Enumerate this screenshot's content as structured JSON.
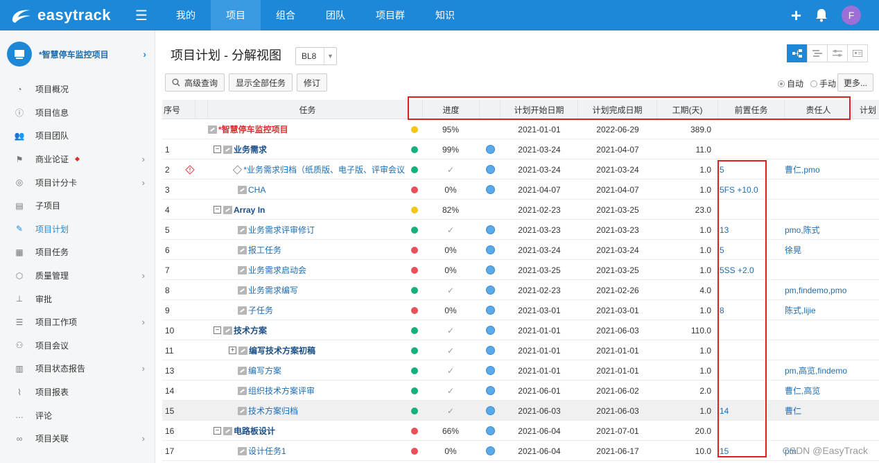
{
  "topbar": {
    "logo_text": "easytrack",
    "nav": [
      "我的",
      "项目",
      "组合",
      "团队",
      "项目群",
      "知识"
    ],
    "active_nav": 1,
    "avatar_letter": "F"
  },
  "sidebar": {
    "project_name": "*智慧停车监控项目",
    "items": [
      {
        "label": "项目概况",
        "icon": "pie-chart-icon",
        "chev": false
      },
      {
        "label": "项目信息",
        "icon": "info-icon",
        "chev": false
      },
      {
        "label": "项目团队",
        "icon": "team-icon",
        "chev": false
      },
      {
        "label": "商业论证",
        "icon": "flag-icon",
        "chev": true,
        "dot": true
      },
      {
        "label": "项目计分卡",
        "icon": "target-icon",
        "chev": true
      },
      {
        "label": "子项目",
        "icon": "subproject-icon",
        "chev": false
      },
      {
        "label": "项目计划",
        "icon": "plan-icon",
        "chev": false,
        "active": true
      },
      {
        "label": "项目任务",
        "icon": "task-icon",
        "chev": false
      },
      {
        "label": "质量管理",
        "icon": "quality-icon",
        "chev": true
      },
      {
        "label": "审批",
        "icon": "stamp-icon",
        "chev": false
      },
      {
        "label": "项目工作项",
        "icon": "workitem-icon",
        "chev": true
      },
      {
        "label": "项目会议",
        "icon": "meeting-icon",
        "chev": false
      },
      {
        "label": "项目状态报告",
        "icon": "report-icon",
        "chev": true
      },
      {
        "label": "项目报表",
        "icon": "chart-icon",
        "chev": false
      },
      {
        "label": "评论",
        "icon": "comment-icon",
        "chev": false
      },
      {
        "label": "项目关联",
        "icon": "link-icon",
        "chev": true
      }
    ]
  },
  "main": {
    "title": "项目计划 - 分解视图",
    "baseline": "BL8",
    "toolbar": {
      "search": "高级查询",
      "show_all": "显示全部任务",
      "revise": "修订"
    },
    "mode": {
      "auto": "自动",
      "manual": "手动"
    },
    "more": "更多..."
  },
  "table": {
    "headers": [
      "序号",
      "任务",
      "进度",
      "计划开始日期",
      "计划完成日期",
      "工期(天)",
      "前置任务",
      "责任人",
      "计划"
    ],
    "rows": [
      {
        "seq": "",
        "level": 0,
        "node": "",
        "icon": "task",
        "name": "*智慧停车监控项目",
        "style": "red",
        "dot": "#f5c518",
        "progress": "95%",
        "badge": false,
        "start": "2021-01-01",
        "end": "2022-06-29",
        "dur": "389.0",
        "pre": "",
        "owner": ""
      },
      {
        "seq": "1",
        "level": 1,
        "node": "⊟",
        "icon": "task",
        "name": "业务需求",
        "style": "bold",
        "dot": "#16b07a",
        "progress": "99%",
        "badge": true,
        "start": "2021-03-24",
        "end": "2021-04-07",
        "dur": "11.0",
        "pre": "",
        "owner": ""
      },
      {
        "seq": "2",
        "level": 2,
        "node": "",
        "icon": "diamond",
        "name": "*业务需求归档（纸质版、电子版、评审会议",
        "style": "",
        "dot": "#16b07a",
        "progress": "✓",
        "badge": true,
        "start": "2021-03-24",
        "end": "2021-03-24",
        "dur": "1.0",
        "pre": "5",
        "owner": "曹仁,pmo",
        "warn": true
      },
      {
        "seq": "3",
        "level": 2,
        "node": "",
        "icon": "task",
        "name": "CHA",
        "style": "",
        "dot": "#e8505b",
        "progress": "0%",
        "badge": true,
        "start": "2021-04-07",
        "end": "2021-04-07",
        "dur": "1.0",
        "pre": "5FS +10.0",
        "owner": ""
      },
      {
        "seq": "4",
        "level": 1,
        "node": "⊟",
        "icon": "task",
        "name": "Array In",
        "style": "bold",
        "dot": "#f5c518",
        "progress": "82%",
        "badge": false,
        "start": "2021-02-23",
        "end": "2021-03-25",
        "dur": "23.0",
        "pre": "",
        "owner": ""
      },
      {
        "seq": "5",
        "level": 2,
        "node": "",
        "icon": "task",
        "name": "业务需求评审修订",
        "style": "",
        "dot": "#16b07a",
        "progress": "✓",
        "badge": true,
        "start": "2021-03-23",
        "end": "2021-03-23",
        "dur": "1.0",
        "pre": "13",
        "owner": "pmo,陈式"
      },
      {
        "seq": "6",
        "level": 2,
        "node": "",
        "icon": "task",
        "name": "报工任务",
        "style": "",
        "dot": "#e8505b",
        "progress": "0%",
        "badge": true,
        "start": "2021-03-24",
        "end": "2021-03-24",
        "dur": "1.0",
        "pre": "5",
        "owner": "徐晃"
      },
      {
        "seq": "7",
        "level": 2,
        "node": "",
        "icon": "task",
        "name": "业务需求启动会",
        "style": "",
        "dot": "#e8505b",
        "progress": "0%",
        "badge": true,
        "start": "2021-03-25",
        "end": "2021-03-25",
        "dur": "1.0",
        "pre": "5SS +2.0",
        "owner": ""
      },
      {
        "seq": "8",
        "level": 2,
        "node": "",
        "icon": "task",
        "name": "业务需求编写",
        "style": "",
        "dot": "#16b07a",
        "progress": "✓",
        "badge": true,
        "start": "2021-02-23",
        "end": "2021-02-26",
        "dur": "4.0",
        "pre": "",
        "owner": "pm,findemo,pmo"
      },
      {
        "seq": "9",
        "level": 2,
        "node": "",
        "icon": "task",
        "name": "子任务",
        "style": "",
        "dot": "#e8505b",
        "progress": "0%",
        "badge": true,
        "start": "2021-03-01",
        "end": "2021-03-01",
        "dur": "1.0",
        "pre": "8",
        "owner": "陈式,lijie"
      },
      {
        "seq": "10",
        "level": 1,
        "node": "⊟",
        "icon": "task",
        "name": "技术方案",
        "style": "bold",
        "dot": "#16b07a",
        "progress": "✓",
        "badge": true,
        "start": "2021-01-01",
        "end": "2021-06-03",
        "dur": "110.0",
        "pre": "",
        "owner": ""
      },
      {
        "seq": "11",
        "level": 2,
        "node": "⊞",
        "icon": "task",
        "name": "编写技术方案初稿",
        "style": "bold",
        "dot": "#16b07a",
        "progress": "✓",
        "badge": true,
        "start": "2021-01-01",
        "end": "2021-01-01",
        "dur": "1.0",
        "pre": "",
        "owner": ""
      },
      {
        "seq": "13",
        "level": 2,
        "node": "",
        "icon": "task",
        "name": "编写方案",
        "style": "",
        "dot": "#16b07a",
        "progress": "✓",
        "badge": true,
        "start": "2021-01-01",
        "end": "2021-01-01",
        "dur": "1.0",
        "pre": "",
        "owner": "pm,高览,findemo"
      },
      {
        "seq": "14",
        "level": 2,
        "node": "",
        "icon": "task",
        "name": "组织技术方案评审",
        "style": "",
        "dot": "#16b07a",
        "progress": "✓",
        "badge": true,
        "start": "2021-06-01",
        "end": "2021-06-02",
        "dur": "2.0",
        "pre": "",
        "owner": "曹仁,高览"
      },
      {
        "seq": "15",
        "level": 2,
        "node": "",
        "icon": "task",
        "name": "技术方案归档",
        "style": "",
        "dot": "#16b07a",
        "progress": "✓",
        "badge": true,
        "start": "2021-06-03",
        "end": "2021-06-03",
        "dur": "1.0",
        "pre": "14",
        "owner": "曹仁",
        "hl": true
      },
      {
        "seq": "16",
        "level": 1,
        "node": "⊟",
        "icon": "task",
        "name": "电路板设计",
        "style": "bold",
        "dot": "#e8505b",
        "progress": "66%",
        "badge": true,
        "start": "2021-06-04",
        "end": "2021-07-01",
        "dur": "20.0",
        "pre": "",
        "owner": ""
      },
      {
        "seq": "17",
        "level": 2,
        "node": "",
        "icon": "task",
        "name": "设计任务1",
        "style": "",
        "dot": "#e8505b",
        "progress": "0%",
        "badge": true,
        "start": "2021-06-04",
        "end": "2021-06-17",
        "dur": "10.0",
        "pre": "15",
        "owner": "pm"
      }
    ]
  },
  "watermark": "CSDN @EasyTrack",
  "colors": {
    "brand": "#1e88d8",
    "highlight": "#e02020",
    "green": "#16b07a",
    "red": "#e8505b",
    "yellow": "#f5c518"
  }
}
